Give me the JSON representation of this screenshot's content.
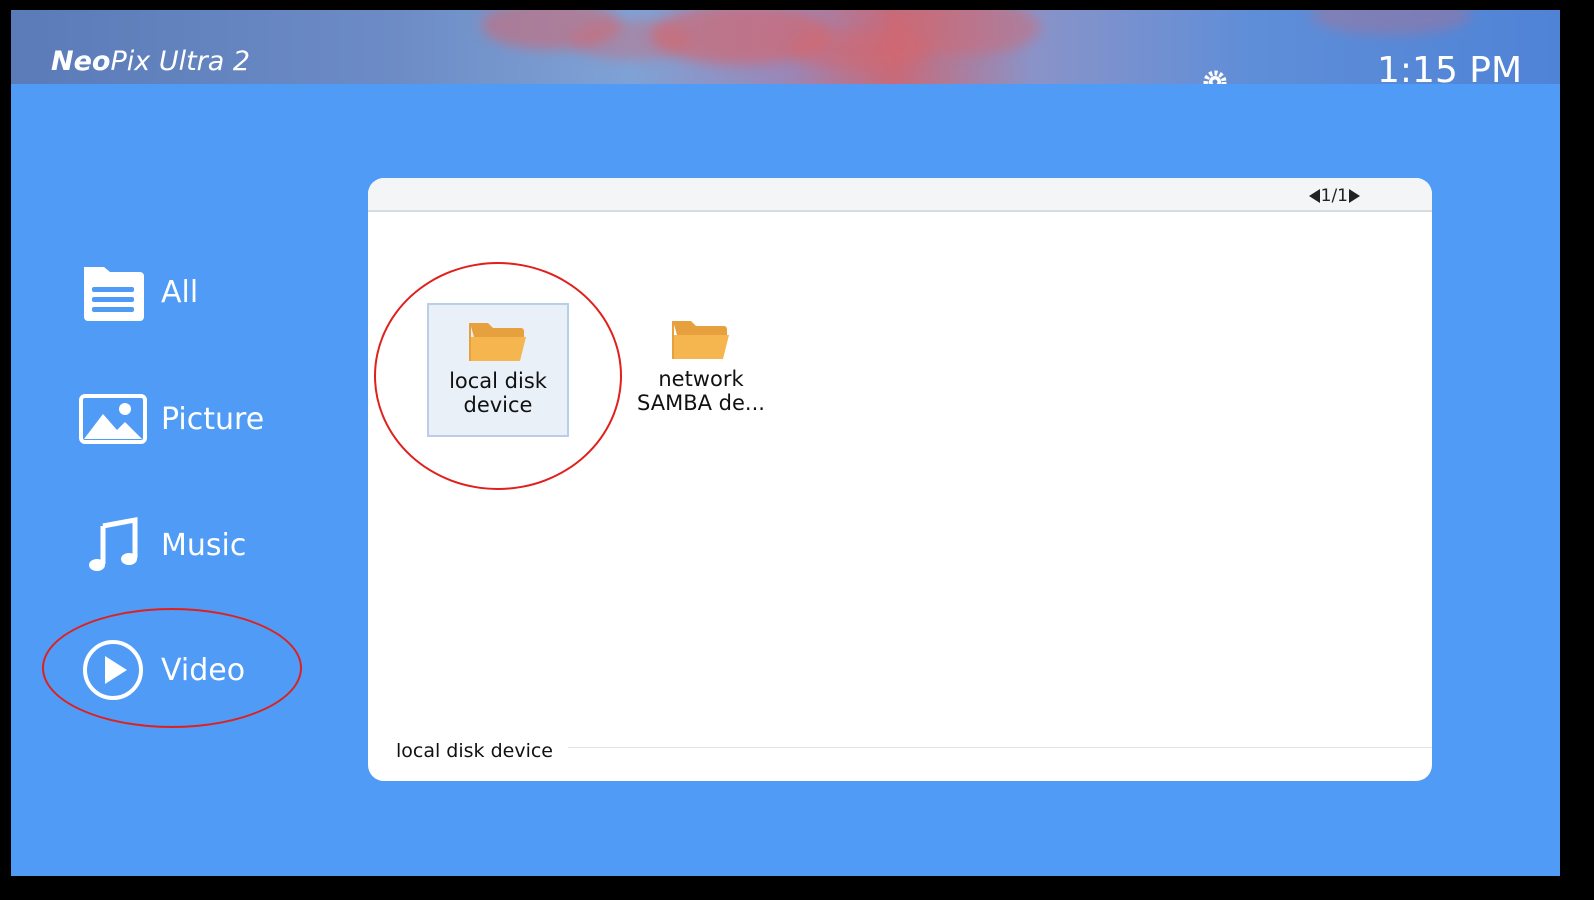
{
  "header": {
    "brand_bold": "Neo",
    "brand_rest": "Pix Ultra 2",
    "time": "1:15 PM"
  },
  "sidebar": {
    "items": [
      {
        "label": "All",
        "icon": "folder-list-icon"
      },
      {
        "label": "Picture",
        "icon": "picture-icon"
      },
      {
        "label": "Music",
        "icon": "music-note-icon"
      },
      {
        "label": "Video",
        "icon": "play-circle-icon"
      }
    ]
  },
  "browser": {
    "page_indicator": "1/1",
    "items": [
      {
        "line1": "local disk",
        "line2": "device",
        "selected": true
      },
      {
        "line1": "network",
        "line2": "SAMBA de...",
        "selected": false
      }
    ],
    "status": "local disk device"
  },
  "colors": {
    "background": "#4f9bf5",
    "folder": "#f5b650",
    "annotation": "#e0201c"
  }
}
